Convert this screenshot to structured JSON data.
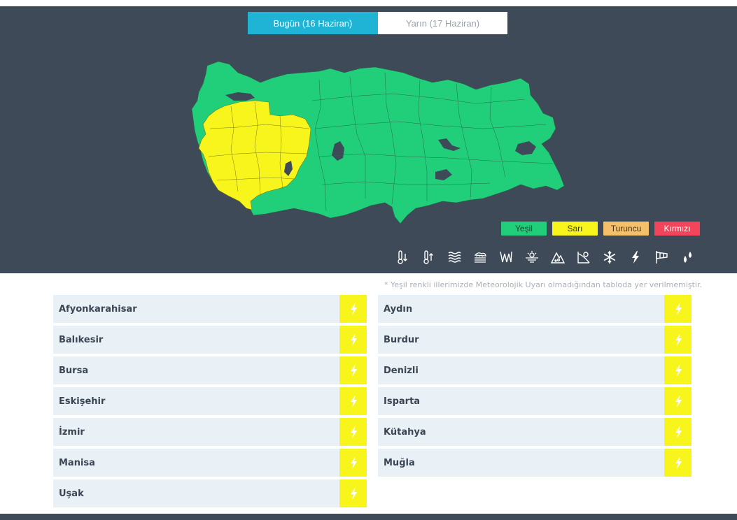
{
  "tabs": [
    {
      "label": "Bugün (16 Haziran)",
      "active": true
    },
    {
      "label": "Yarın (17 Haziran)",
      "active": false
    }
  ],
  "legend": [
    {
      "label": "Yeşil",
      "color": "#21cf7b"
    },
    {
      "label": "Sarı",
      "color": "#f7f51c"
    },
    {
      "label": "Turuncu",
      "color": "#f5c06a"
    },
    {
      "label": "Kırmızı",
      "color": "#f2455b"
    }
  ],
  "hazard_icons": [
    "cold-icon",
    "heat-icon",
    "fog-icon",
    "snow-rain-icon",
    "wind-icon",
    "dust-icon",
    "avalanche-icon",
    "frost-icon",
    "snow-icon",
    "thunderstorm-icon",
    "windsock-icon",
    "rain-icon"
  ],
  "footnote": "* Yeşil renkli illerimizde Meteorolojik Uyarı olmadığından tabloda yer verilmemiştir.",
  "provinces_left": [
    "Afyonkarahisar",
    "Balıkesir",
    "Bursa",
    "Eskişehir",
    "İzmir",
    "Manisa",
    "Uşak"
  ],
  "provinces_right": [
    "Aydın",
    "Burdur",
    "Denizli",
    "Isparta",
    "Kütahya",
    "Muğla"
  ],
  "warning": {
    "type": "thunderstorm",
    "level": "Sarı",
    "color": "#f7f51c"
  },
  "map_colors": {
    "green": "#21cf7b",
    "yellow": "#f7f51c",
    "lake": "#3e4a58"
  }
}
